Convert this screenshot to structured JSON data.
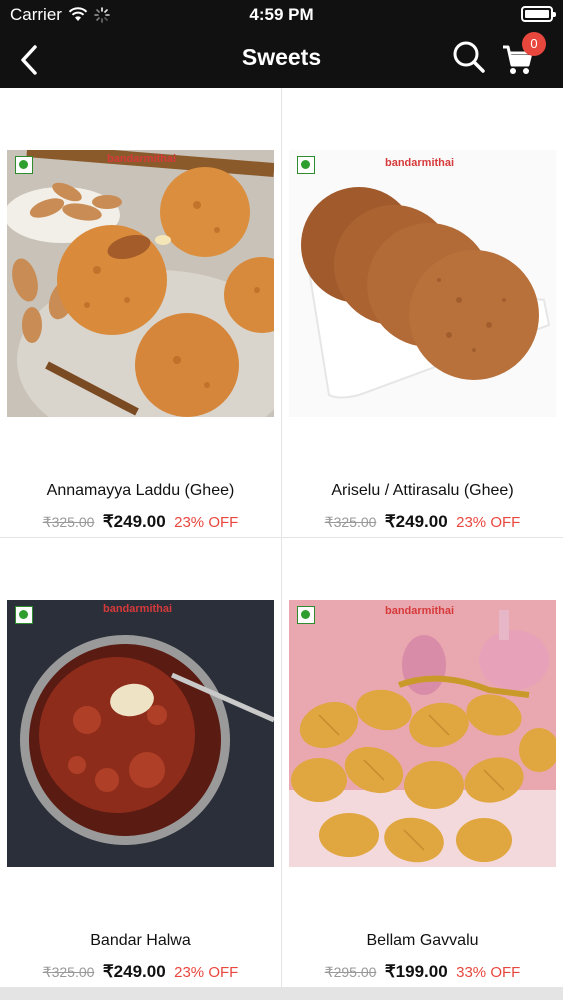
{
  "status": {
    "carrier": "Carrier",
    "time": "4:59 PM"
  },
  "nav": {
    "title": "Sweets",
    "cart_count": "0"
  },
  "brand_watermark": "bandarmithai",
  "products": [
    {
      "name": "Annamayya Laddu (Ghee)",
      "mrp": "₹325.00",
      "price": "₹249.00",
      "discount": "23% OFF"
    },
    {
      "name": "Ariselu / Attirasalu (Ghee)",
      "mrp": "₹325.00",
      "price": "₹249.00",
      "discount": "23% OFF"
    },
    {
      "name": "Bandar Halwa",
      "mrp": "₹325.00",
      "price": "₹249.00",
      "discount": "23% OFF"
    },
    {
      "name": "Bellam Gavvalu",
      "mrp": "₹295.00",
      "price": "₹199.00",
      "discount": "33% OFF"
    }
  ],
  "colors": {
    "header_bg": "#111111",
    "discount": "#e8473e",
    "badge": "#e8473e",
    "veg": "#2e9e2e"
  }
}
